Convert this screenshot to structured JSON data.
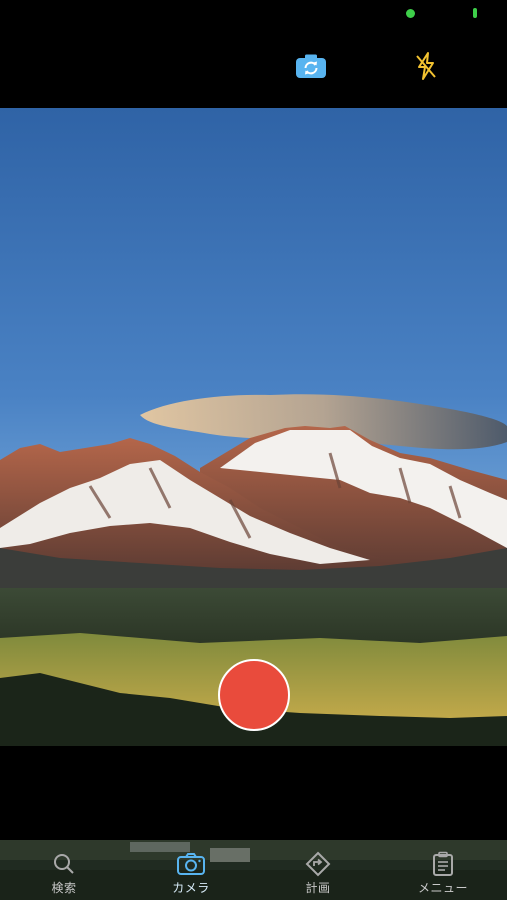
{
  "status_bar": {
    "indicator_color": "#3ecf4a"
  },
  "top_controls": {
    "switch_camera_icon": "camera-rotate-icon",
    "flash_icon": "flash-off-icon",
    "accent_color": "#58b4f0",
    "flash_color": "#f2c230"
  },
  "camera": {
    "shutter_color": "#e94b3c"
  },
  "tabbar": {
    "items": [
      {
        "label": "検索",
        "icon": "search-icon",
        "active": false
      },
      {
        "label": "カメラ",
        "icon": "camera-icon",
        "active": true
      },
      {
        "label": "計画",
        "icon": "diamond-directions-icon",
        "active": false
      },
      {
        "label": "メニュー",
        "icon": "clipboard-icon",
        "active": false
      }
    ]
  }
}
